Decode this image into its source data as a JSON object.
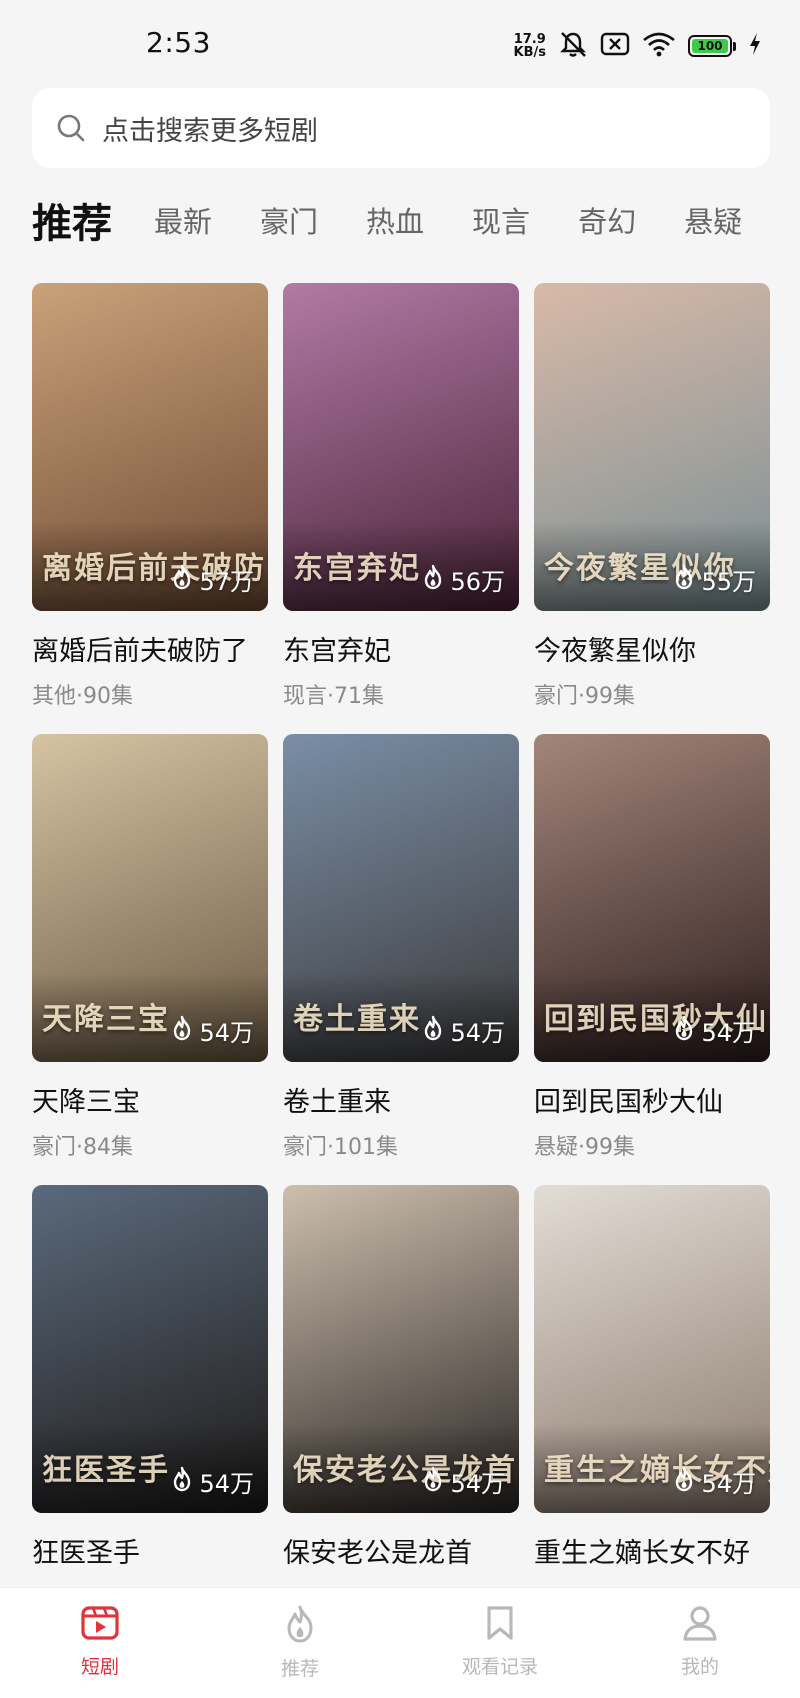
{
  "status_bar": {
    "time": "2:53",
    "net_speed_value": "17.9",
    "net_speed_unit": "KB/s",
    "battery": "100",
    "icons": [
      "mute-icon",
      "sim-x-icon",
      "wifi-icon",
      "battery-icon",
      "charging-icon"
    ]
  },
  "search": {
    "placeholder": "点击搜索更多短剧"
  },
  "tabs": [
    "推荐",
    "最新",
    "豪门",
    "热血",
    "现言",
    "奇幻",
    "悬疑"
  ],
  "active_tab": "推荐",
  "dramas": [
    {
      "title": "离婚后前夫破防了",
      "meta": "其他·90集",
      "heat": "57万",
      "poster_text": "离婚后前夫破防了",
      "colors": [
        "#c9a27a",
        "#6e4a33"
      ]
    },
    {
      "title": "东宫弃妃",
      "meta": "现言·71集",
      "heat": "56万",
      "poster_text": "东宫弃妃",
      "colors": [
        "#b27aa6",
        "#4a2438"
      ]
    },
    {
      "title": "今夜繁星似你",
      "meta": "豪门·99集",
      "heat": "55万",
      "poster_text": "今夜繁星似你",
      "colors": [
        "#d8b9a8",
        "#7a8f94"
      ]
    },
    {
      "title": "天降三宝",
      "meta": "豪门·84集",
      "heat": "54万",
      "poster_text": "天降三宝",
      "colors": [
        "#d6c3a3",
        "#6b5a44"
      ]
    },
    {
      "title": "卷土重来",
      "meta": "豪门·101集",
      "heat": "54万",
      "poster_text": "卷土重来",
      "colors": [
        "#7a8ea6",
        "#3b3a3a"
      ]
    },
    {
      "title": "回到民国秒大仙",
      "meta": "悬疑·99集",
      "heat": "54万",
      "poster_text": "回到民国秒大仙",
      "colors": [
        "#a3867a",
        "#2e1e1e"
      ]
    },
    {
      "title": "狂医圣手",
      "meta": "",
      "heat": "54万",
      "poster_text": "狂医圣手",
      "colors": [
        "#5a6a7c",
        "#1e1a18"
      ]
    },
    {
      "title": "保安老公是龙首",
      "meta": "",
      "heat": "54万",
      "poster_text": "保安老公是龙首",
      "colors": [
        "#cdbfae",
        "#2a2624"
      ]
    },
    {
      "title": "重生之嫡长女不好",
      "meta": "",
      "heat": "54万",
      "poster_text": "重生之嫡长女不好惹",
      "colors": [
        "#e3ddd6",
        "#8a7a6c"
      ]
    }
  ],
  "bottom_nav": [
    {
      "label": "短剧",
      "icon": "short-drama-icon",
      "active": true
    },
    {
      "label": "推荐",
      "icon": "flame-icon",
      "active": false
    },
    {
      "label": "观看记录",
      "icon": "bookmark-icon",
      "active": false
    },
    {
      "label": "我的",
      "icon": "profile-icon",
      "active": false
    }
  ],
  "colors": {
    "accent": "#e0333a",
    "inactive": "#b8b8b8",
    "background": "#f5f5f5"
  }
}
